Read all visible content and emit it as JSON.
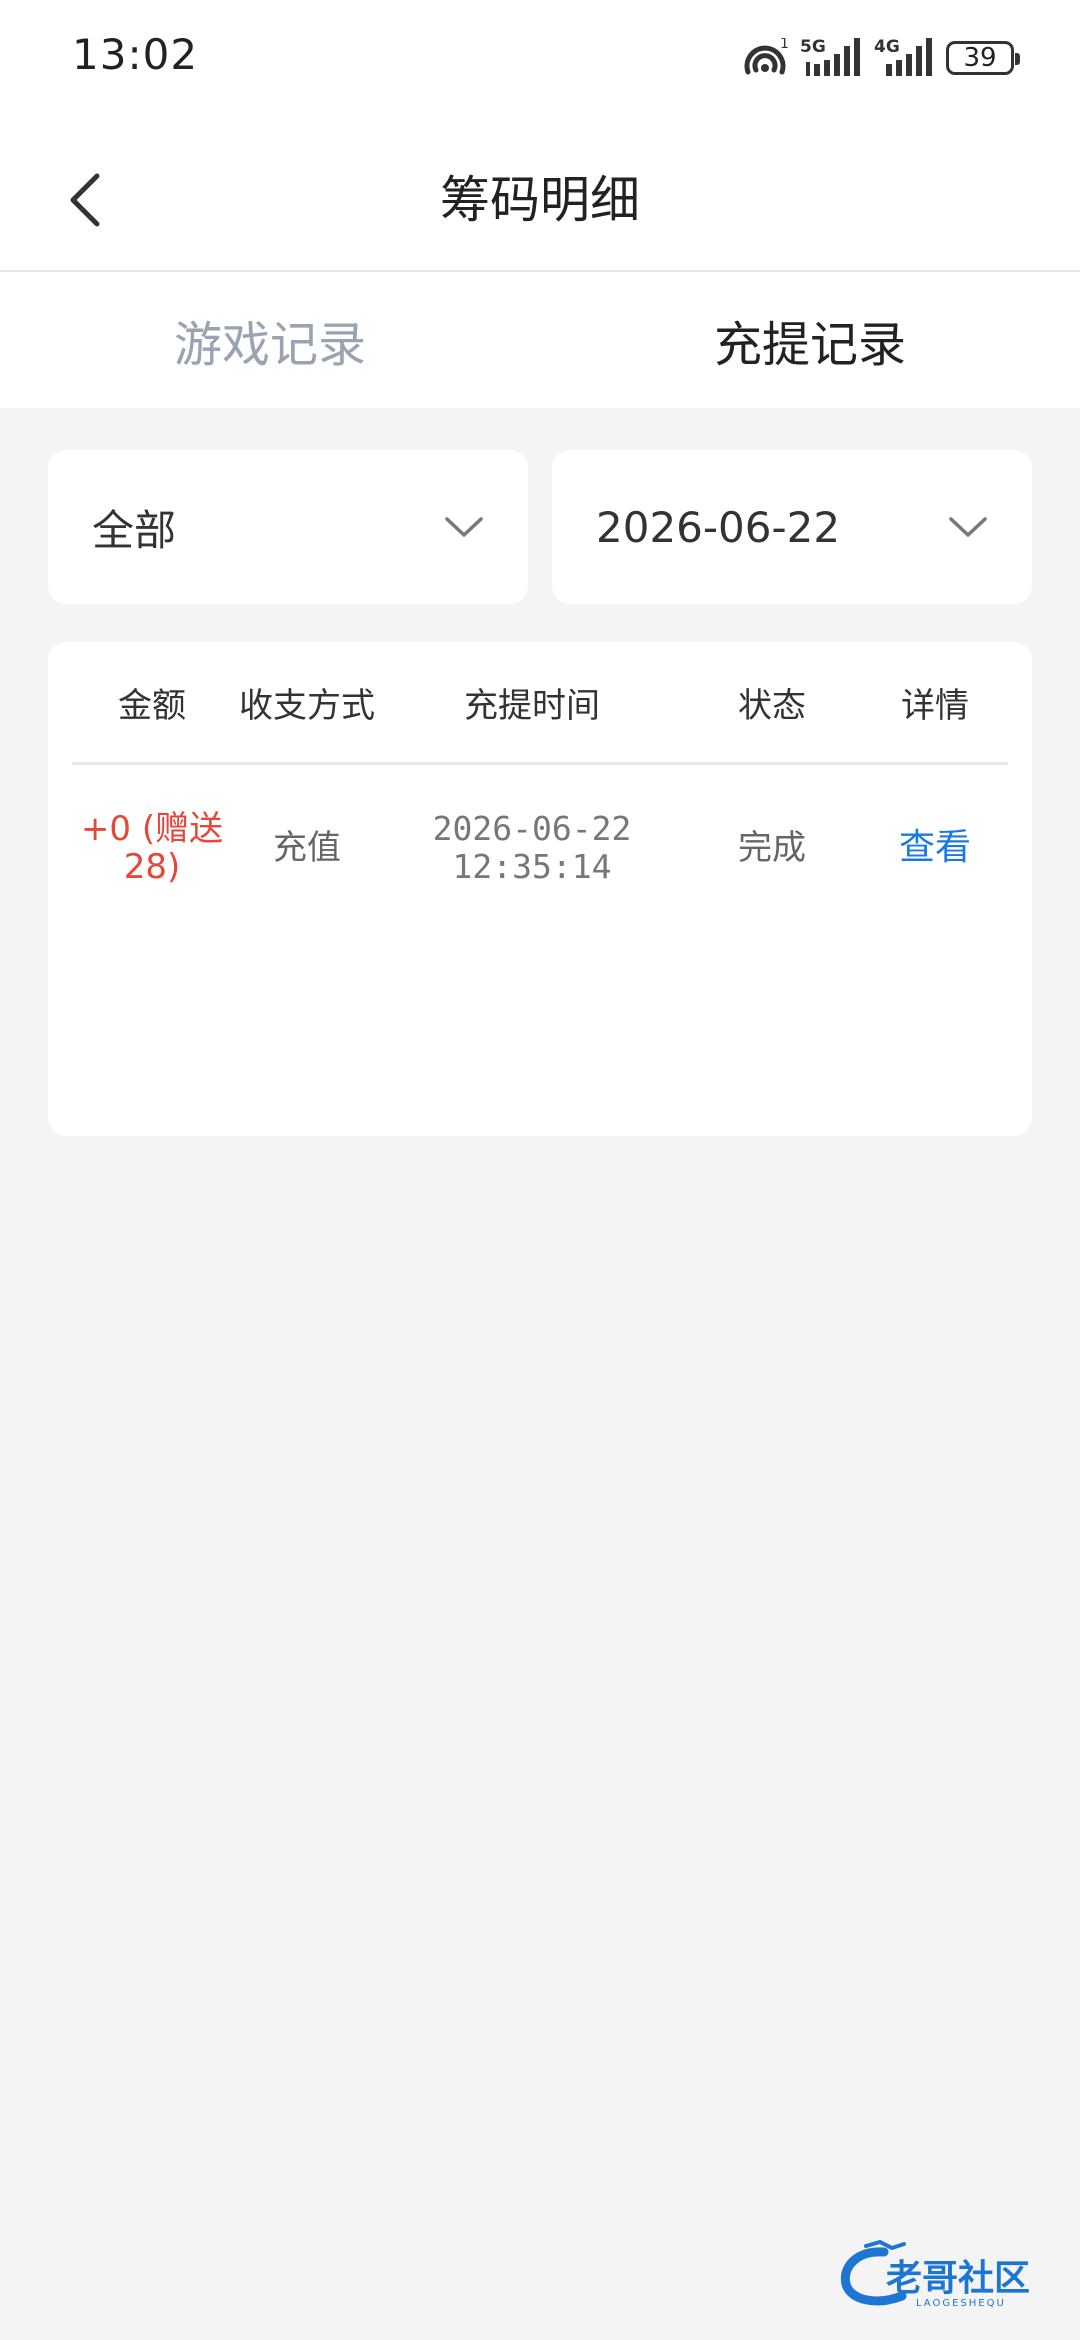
{
  "status_bar": {
    "time": "13:02",
    "battery": "39",
    "network_a": "5G",
    "network_b": "4G",
    "sim_index": "1"
  },
  "header": {
    "title": "筹码明细"
  },
  "tabs": [
    {
      "label": "游戏记录",
      "active": false
    },
    {
      "label": "充提记录",
      "active": true
    }
  ],
  "filters": {
    "type_selected": "全部",
    "date_selected": "2026-06-22"
  },
  "table": {
    "columns": [
      "金额",
      "收支方式",
      "充提时间",
      "状态",
      "详情"
    ],
    "rows": [
      {
        "amount": "+0 (赠送28)",
        "method": "充值",
        "date": "2026-06-22",
        "time": "12:35:14",
        "status": "完成",
        "detail": "查看"
      }
    ]
  },
  "watermark": {
    "text": "老哥社区",
    "subtext": "LAOGESHEQU"
  },
  "colors": {
    "amount": "#e5473a",
    "link": "#1a7ae0",
    "tab_inactive": "#9aa3b2",
    "page_bg": "#f4f4f5"
  }
}
